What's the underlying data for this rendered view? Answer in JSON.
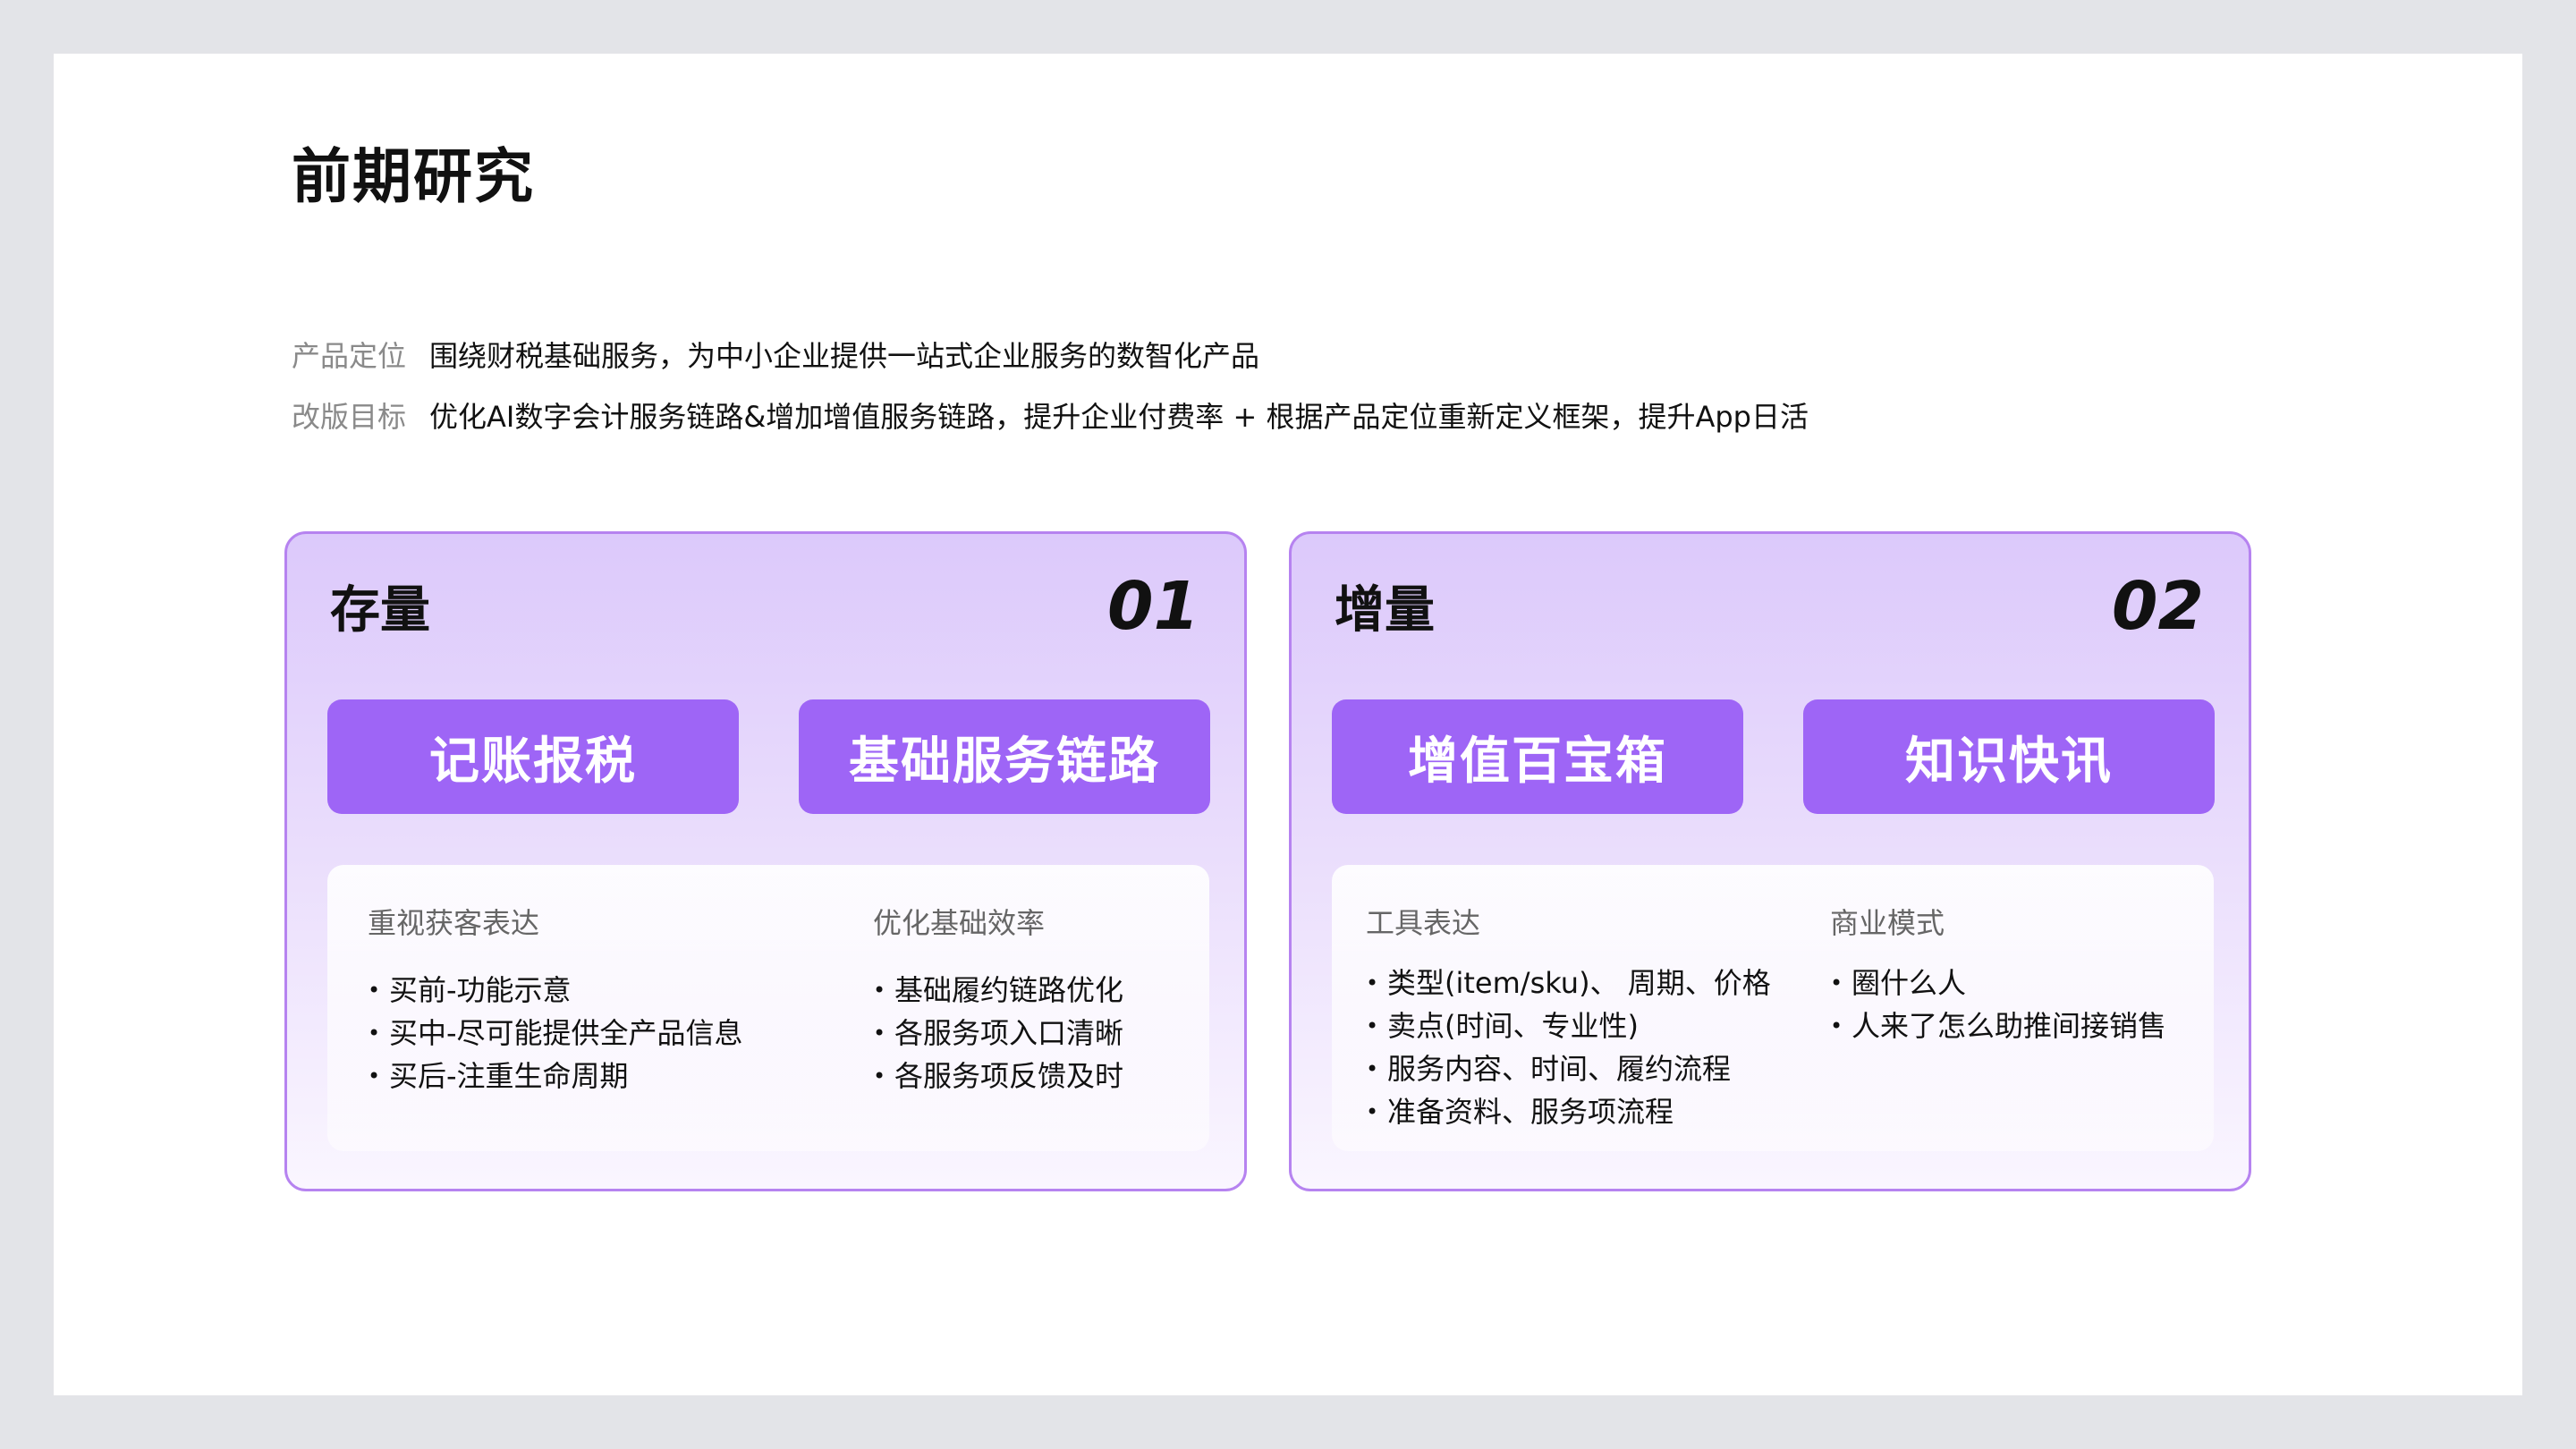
{
  "title": "前期研究",
  "info": {
    "positioning_label": "产品定位",
    "positioning_value": "围绕财税基础服务，为中小企业提供一站式企业服务的数智化产品",
    "goal_label": "改版目标",
    "goal_value": "优化AI数字会计服务链路&增加增值服务链路，提升企业付费率 + 根据产品定位重新定义框架，提升App日活"
  },
  "cards": [
    {
      "title": "存量",
      "number": "01",
      "pills": [
        "记账报税",
        "基础服务链路"
      ],
      "columns": [
        {
          "heading": "重视获客表达",
          "items": [
            "买前-功能示意",
            "买中-尽可能提供全产品信息",
            "买后-注重生命周期"
          ]
        },
        {
          "heading": "优化基础效率",
          "items": [
            "基础履约链路优化",
            "各服务项入口清晰",
            "各服务项反馈及时"
          ]
        }
      ]
    },
    {
      "title": "增量",
      "number": "02",
      "pills": [
        "增值百宝箱",
        "知识快讯"
      ],
      "columns": [
        {
          "heading": "工具表达",
          "items": [
            "类型(item/sku)、 周期、价格",
            "卖点(时间、专业性)",
            "服务内容、时间、履约流程",
            "准备资料、服务项流程"
          ]
        },
        {
          "heading": "商业模式",
          "items": [
            "圈什么人",
            "人来了怎么助推间接销售"
          ]
        }
      ]
    }
  ]
}
